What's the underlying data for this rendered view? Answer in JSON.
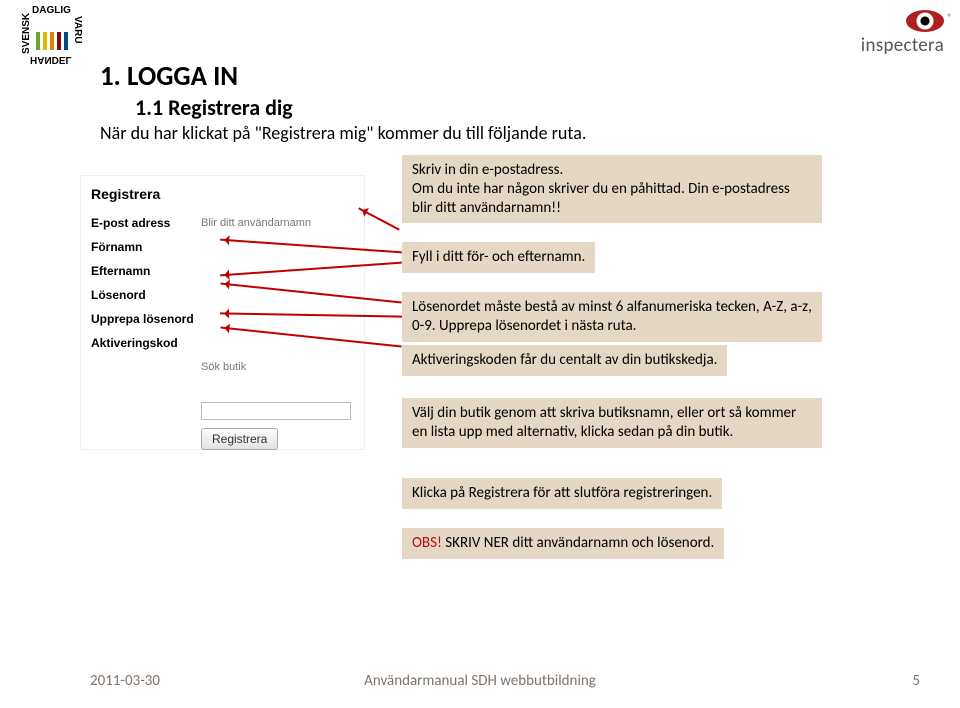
{
  "logo_left": {
    "top": "SVENSK",
    "right": "DAGLIG",
    "bottom": "HANDEL",
    "left": "VARU"
  },
  "logo_right": {
    "text": "inspectera",
    "reg": "®"
  },
  "heading": {
    "num_title": "1.   LOGGA IN",
    "sub_num": "1.1 Registrera dig",
    "intro": "När du har klickat på \"Registrera mig\" kommer du till följande ruta."
  },
  "form": {
    "title": "Registrera",
    "rows": {
      "email_label": "E-post adress",
      "email_hint": "Blir ditt användarnamn",
      "firstname": "Förnamn",
      "lastname": "Efternamn",
      "password": "Lösenord",
      "password2": "Upprepa lösenord",
      "activation": "Aktiveringskod",
      "search_hint": "Sök butik",
      "button": "Registrera"
    }
  },
  "callouts": {
    "c1a": "Skriv in din e-postadress.",
    "c1b": "Om du inte har någon skriver du en påhittad. Din e-postadress blir ditt användarnamn!!",
    "c2": "Fyll i ditt för- och efternamn.",
    "c3": "Lösenordet måste bestå av minst 6 alfanumeriska tecken, A-Z, a-z, 0-9. Upprepa lösenordet i nästa ruta.",
    "c4": "Aktiveringskoden får du centalt av din butikskedja.",
    "c5": "Välj din butik genom att skriva butiksnamn, eller ort så kommer en lista upp med alternativ, klicka sedan på din butik.",
    "c6": "Klicka på Registrera för att slutföra registreringen.",
    "c7a": "OBS!",
    "c7b": " SKRIV NER ditt användarnamn och lösenord."
  },
  "footer": {
    "date": "2011-03-30",
    "title": "Användarmanual SDH webbutbildning",
    "page": "5"
  }
}
